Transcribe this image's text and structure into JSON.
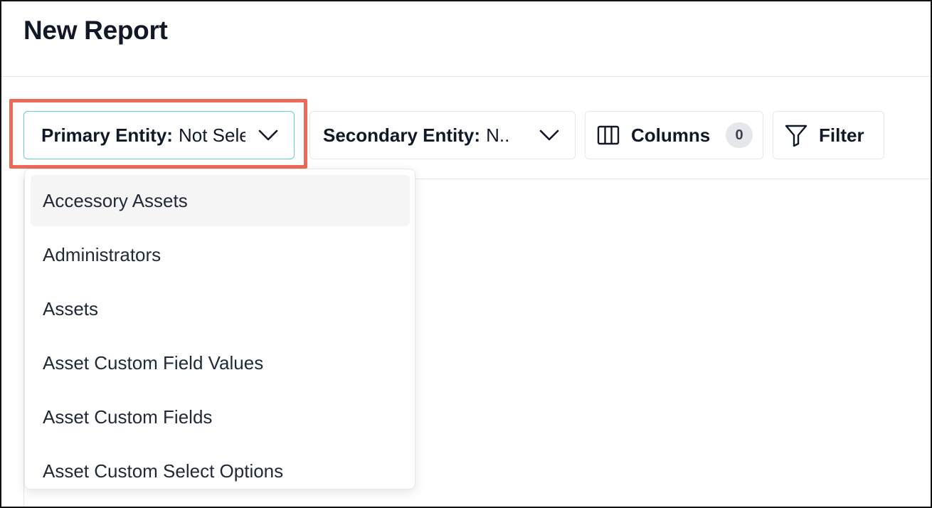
{
  "page": {
    "title": "New Report"
  },
  "toolbar": {
    "primary_entity": {
      "label": "Primary Entity:",
      "value": "Not Selected"
    },
    "secondary_entity": {
      "label": "Secondary Entity:",
      "value": "N.."
    },
    "columns": {
      "label": "Columns",
      "count": "0"
    },
    "filter": {
      "label": "Filter"
    }
  },
  "dropdown": {
    "items": [
      {
        "label": "Accessory Assets",
        "active": true
      },
      {
        "label": "Administrators"
      },
      {
        "label": "Assets"
      },
      {
        "label": "Asset Custom Field Values"
      },
      {
        "label": "Asset Custom Fields"
      },
      {
        "label": "Asset Custom Select Options"
      }
    ]
  },
  "colors": {
    "highlight": "#ec6a57",
    "focus_border": "#5fd0c8"
  }
}
